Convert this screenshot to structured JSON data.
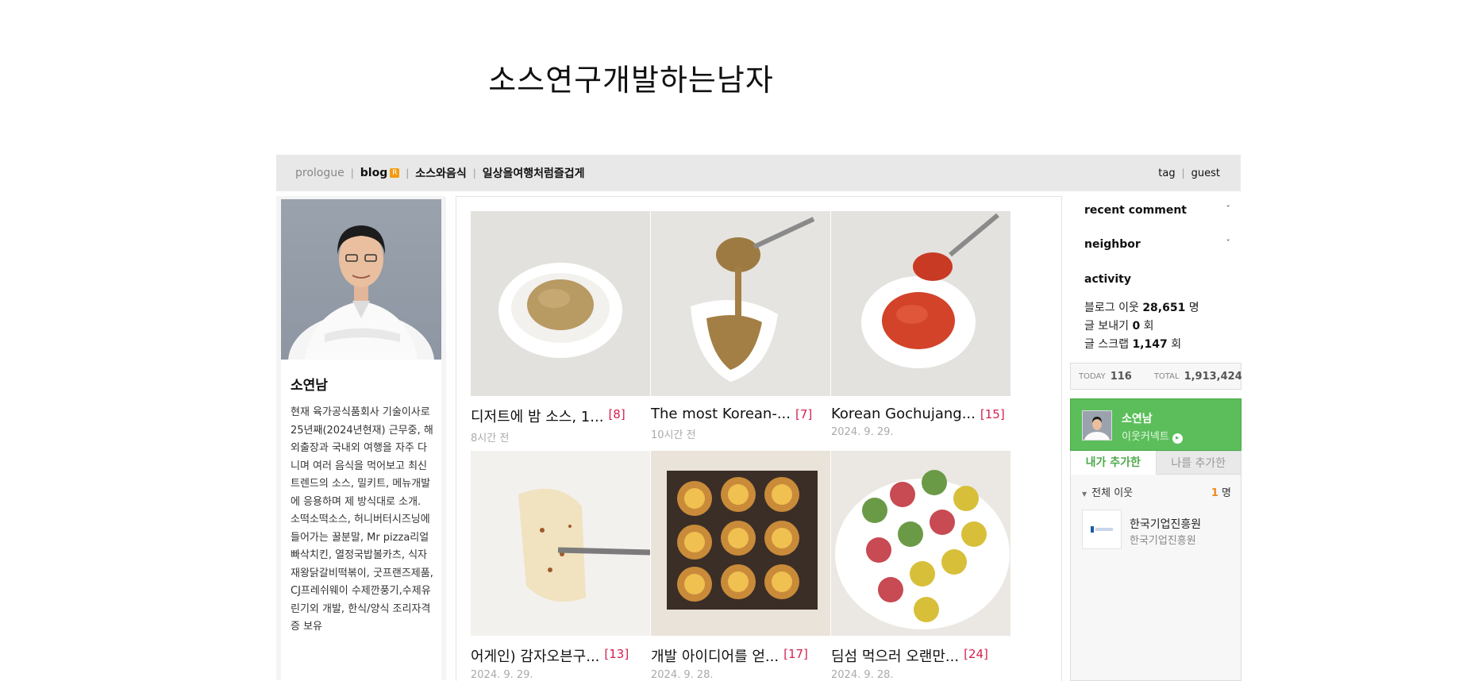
{
  "blog": {
    "title": "소스연구개발하는남자"
  },
  "menu": {
    "left": [
      {
        "label": "prologue",
        "dim": true
      },
      {
        "label": "blog"
      },
      {
        "label": "소스와음식"
      },
      {
        "label": "일상을여행처럼즐겁게"
      }
    ],
    "rss": "R",
    "right": [
      {
        "label": "tag"
      },
      {
        "label": "guest"
      }
    ]
  },
  "profile": {
    "name": "소연남",
    "description": "현재 육가공식품회사 기술이사로 25년째(2024년현재) 근무중, 해외출장과 국내외 여행을 자주 다니며 여러 음식을 먹어보고 최신 트렌드의 소스, 밀키트, 메뉴개발에 응용하며 제 방식대로 소개. 소떡소떡소스, 허니버터시즈닝에 들어가는 꿀분말, Mr pizza리얼빠삭치킨, 열정국밥볼카츠, 식자재왕닭갈비떡볶이, 굿프랜즈제품, CJ프레쉬웨이 수제깐풍기,수제유린기외 개발, 한식/양식 조리자격증 보유"
  },
  "posts": [
    {
      "title": "디저트에 밤 소스, 1...",
      "comments": "[8]",
      "date": "8시간 전"
    },
    {
      "title": "The most Korean-...",
      "comments": "[7]",
      "date": "10시간 전"
    },
    {
      "title": "Korean Gochujang...",
      "comments": "[15]",
      "date": "2024. 9. 29."
    },
    {
      "title": "어게인) 감자오븐구...",
      "comments": "[13]",
      "date": "2024. 9. 29."
    },
    {
      "title": "개발 아이디어를 얻...",
      "comments": "[17]",
      "date": "2024. 9. 28."
    },
    {
      "title": "딤섬 먹으러 오랜만...",
      "comments": "[24]",
      "date": "2024. 9. 28."
    }
  ],
  "sidebar": {
    "recent_comment": "recent comment",
    "neighbor": "neighbor",
    "activity": "activity",
    "chevron": "ˇ",
    "stats": [
      {
        "label": "블로그 이웃",
        "value": "28,651",
        "unit": "명"
      },
      {
        "label": "글 보내기",
        "value": "0",
        "unit": "회"
      },
      {
        "label": "글 스크랩",
        "value": "1,147",
        "unit": "회"
      }
    ],
    "today_label": "TODAY",
    "today_value": "116",
    "total_label": "TOTAL",
    "total_value": "1,913,424",
    "neighbor_box": {
      "name": "소연남",
      "connect": "이웃커넥트",
      "go_icon": "▸"
    },
    "tabs": {
      "mine": "내가 추가한",
      "others": "나를 추가한"
    },
    "all_neighbors": "전체 이웃",
    "count_value": "1",
    "count_unit": "명",
    "neighbor_items": [
      {
        "name": "한국기업진흥원",
        "desc": "한국기업진흥원"
      }
    ]
  }
}
